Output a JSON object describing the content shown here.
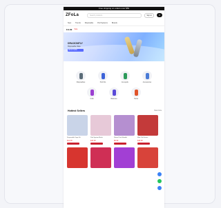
{
  "topbar": {
    "text": "Free shipping on orders over $59"
  },
  "header": {
    "logo": "ZFoLa",
    "search_placeholder": "Search products",
    "account_label": "Sign in",
    "cart_label": "0"
  },
  "nav": [
    "New",
    "Trends",
    "Disposable",
    "Pod Systems",
    "Brands"
  ],
  "crumb": {
    "price": "$ 9.99",
    "tag": "Sale"
  },
  "banner": {
    "title": "DRAGONFLY",
    "subtitle": "Disposable Vape",
    "strip": "SHOP NOW"
  },
  "categories": [
    {
      "label": "Disposables",
      "color": "#5b6c78"
    },
    {
      "label": "Pod Kits",
      "color": "#3d63d8"
    },
    {
      "label": "E-Liquids",
      "color": "#2c9a5a"
    },
    {
      "label": "Accessories",
      "color": "#4a7bd6"
    },
    {
      "label": "Coils",
      "color": "#9b3fd1"
    },
    {
      "label": "Batteries",
      "color": "#5a4ad8"
    },
    {
      "label": "Tanks",
      "color": "#e0542a"
    }
  ],
  "section": {
    "title": "Hottest Sellers",
    "link": "View more"
  },
  "products": [
    {
      "name": "Disposable Vape Kit",
      "price": "$12.99",
      "color": "#c9d4e8"
    },
    {
      "name": "Pod System Mesh",
      "price": "$15.99",
      "color": "#e7c9d8"
    },
    {
      "name": "Flavor Pack Bundle",
      "price": "$9.99",
      "color": "#b58fd0"
    },
    {
      "name": "Max Puff Series",
      "price": "$18.99",
      "color": "#c33a3a"
    },
    {
      "name": "Mini Stick Vape",
      "price": "$8.99",
      "color": "#d7352f"
    },
    {
      "name": "Crystal Bar Pro",
      "price": "$11.99",
      "color": "#cf2f55"
    },
    {
      "name": "Neon Pod Kit",
      "price": "$14.99",
      "color": "#a23fd4"
    },
    {
      "name": "Ice Series Bar",
      "price": "$10.99",
      "color": "#d8433a"
    }
  ]
}
